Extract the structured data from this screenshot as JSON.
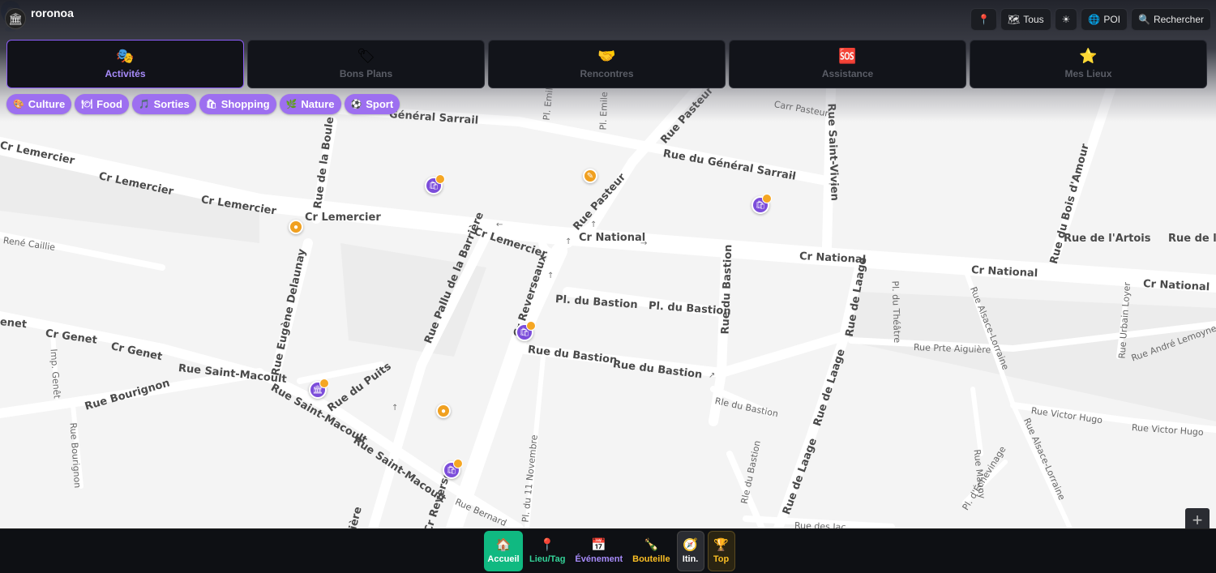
{
  "app": {
    "name": "roronoa",
    "logo_icon": "bank-icon"
  },
  "top_actions": [
    {
      "icon": "pin-icon",
      "glyph": "📍",
      "label": ""
    },
    {
      "icon": "map-icon",
      "glyph": "🗺",
      "label": "Tous"
    },
    {
      "icon": "sun-icon",
      "glyph": "☀",
      "label": ""
    },
    {
      "icon": "globe-icon",
      "glyph": "🌐",
      "label": "POI"
    },
    {
      "icon": "search-icon",
      "glyph": "🔍",
      "label": "Rechercher"
    }
  ],
  "tabs": [
    {
      "label": "Activités",
      "icon": "theater-masks-icon",
      "glyph": "🎭",
      "active": true
    },
    {
      "label": "Bons Plans",
      "icon": "tag-icon",
      "glyph": "🏷",
      "active": false
    },
    {
      "label": "Rencontres",
      "icon": "handshake-icon",
      "glyph": "🤝",
      "active": false
    },
    {
      "label": "Assistance",
      "icon": "sos-icon",
      "glyph": "🆘",
      "active": false
    },
    {
      "label": "Mes Lieux",
      "icon": "star-icon",
      "glyph": "⭐",
      "active": false
    }
  ],
  "categories": [
    {
      "label": "Culture",
      "icon": "palette-icon",
      "glyph": "🎨"
    },
    {
      "label": "Food",
      "icon": "plate-icon",
      "glyph": "🍽"
    },
    {
      "label": "Sorties",
      "icon": "music-icon",
      "glyph": "🎵"
    },
    {
      "label": "Shopping",
      "icon": "shopping-icon",
      "glyph": "🛍"
    },
    {
      "label": "Nature",
      "icon": "leaf-icon",
      "glyph": "🌿"
    },
    {
      "label": "Sport",
      "icon": "ball-icon",
      "glyph": "⚽"
    }
  ],
  "map": {
    "streets": [
      "Cr Lemercier",
      "Cr Lemercier",
      "Cr Lemercier",
      "Cr Lemercier",
      "Cr Lemercier",
      "Cr National",
      "Cr National",
      "Cr National",
      "Cr National",
      "Rue du Général Sarrail",
      "Général Sarrail",
      "Carr Pasteur",
      "Rue Pasteur",
      "Rue Pasteur",
      "Rue Saint-Vivien",
      "Rue du Bois d'Amour",
      "Rue de l'Artois",
      "Rue de l'Ar",
      "Rue de la Boule",
      "René Caillie",
      "Rue Eugène Delaunay",
      "Rue Pallu de la Barrière",
      "Cr Reverseaux",
      "Pl. du Bastion",
      "Pl. du Bastion",
      "Rue du Bastion",
      "Rue du Bastion",
      "Rue du Bastion",
      "Rle du Bastion",
      "Rle du Bastion",
      "Rue de Laage",
      "Rue de Laage",
      "Rue de Laage",
      "Pl. du Théâtre",
      "Rue Prte Aiguière",
      "Rue Alsace-Lorraine",
      "Rue Alsace-Lorraine",
      "Rue Urbain Loyer",
      "Rue André Lemoyne",
      "Rue Victor Hugo",
      "Rue Victor Hugo",
      "Rue Mauny",
      "Pl. d'Échevinage",
      "Cr Genet",
      "Cr Genet",
      "enet",
      "Imp. Genêt",
      "Rue Bourignon",
      "Rue Bourignon",
      "Rue Saint-Macoult",
      "Rue Saint-Macoult",
      "Rue Saint-Macoult",
      "Rue du Puits",
      "Pl. du 11 Novembre",
      "Rue Bernard",
      "Cr Reverse",
      "rière",
      "Pl. Emile",
      "Pl. Emile",
      "Rue des Jac"
    ],
    "markers": [
      {
        "type": "activity",
        "icon": "shopping-icon"
      },
      {
        "type": "food",
        "icon": "food-icon"
      },
      {
        "type": "activity",
        "icon": "shopping-icon"
      },
      {
        "type": "food",
        "icon": "food-icon"
      },
      {
        "type": "activity",
        "icon": "shopping-icon"
      },
      {
        "type": "activity",
        "icon": "museum-icon"
      },
      {
        "type": "food",
        "icon": "food-icon"
      },
      {
        "type": "activity",
        "icon": "shopping-icon"
      }
    ],
    "current_location": "location-pin-icon",
    "zoom_in": "+"
  },
  "bottom_nav": [
    {
      "label": "Accueil",
      "icon": "home-icon",
      "glyph": "🏠",
      "active": true
    },
    {
      "label": "Lieu/Tag",
      "icon": "pin-icon",
      "glyph": "📍",
      "active": false
    },
    {
      "label": "Événement",
      "icon": "calendar-icon",
      "glyph": "📅",
      "active": false
    },
    {
      "label": "Bouteille",
      "icon": "bottle-icon",
      "glyph": "🍾",
      "active": false
    },
    {
      "label": "Itin.",
      "icon": "compass-icon",
      "glyph": "🧭",
      "active": false
    },
    {
      "label": "Top",
      "icon": "trophy-icon",
      "glyph": "🏆",
      "active": false
    }
  ],
  "colors": {
    "accent": "#8b5cf6",
    "chip": "#9d6ff0",
    "accueil": "#10b981",
    "marker_purple": "#7c4dda",
    "marker_orange": "#f0a020",
    "pin_blue": "#2f7bea"
  }
}
